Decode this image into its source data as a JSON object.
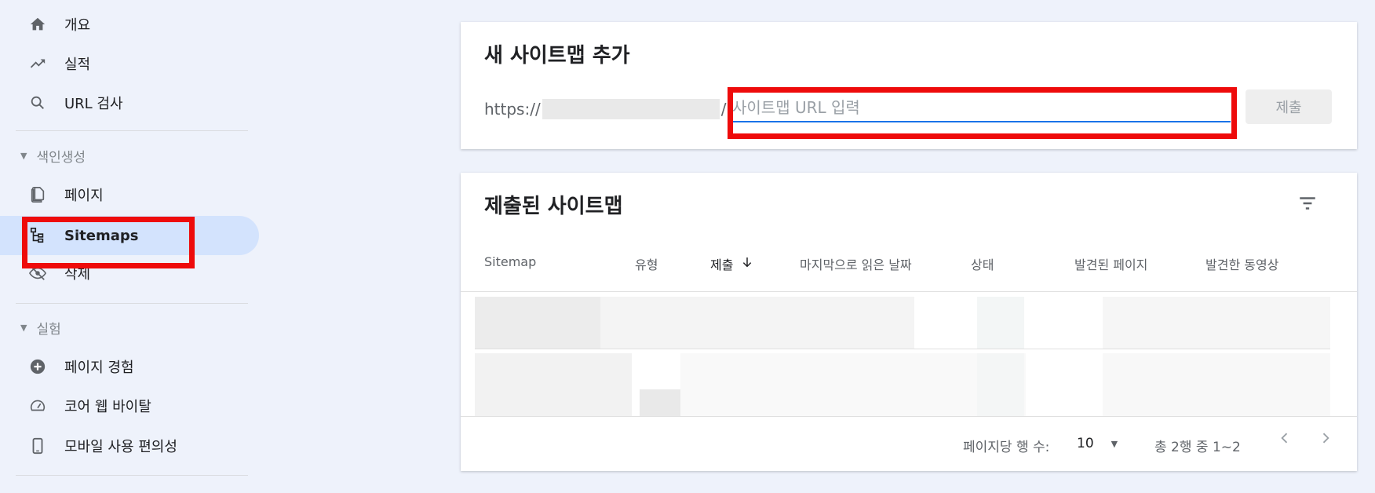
{
  "sidebar": {
    "items": [
      {
        "label": "개요",
        "icon": "home-icon"
      },
      {
        "label": "실적",
        "icon": "trending-up-icon"
      },
      {
        "label": "URL 검사",
        "icon": "search-icon"
      }
    ],
    "index_section": {
      "title": "색인생성",
      "items": [
        {
          "label": "페이지",
          "icon": "pages-icon"
        },
        {
          "label": "Sitemaps",
          "icon": "sitemap-icon",
          "active": true
        },
        {
          "label": "삭제",
          "icon": "visibility-off-icon"
        }
      ]
    },
    "experience_section": {
      "title": "실험",
      "items": [
        {
          "label": "페이지 경험",
          "icon": "plus-circle-icon"
        },
        {
          "label": "코어 웹 바이탈",
          "icon": "speed-gauge-icon"
        },
        {
          "label": "모바일 사용 편의성",
          "icon": "smartphone-icon"
        }
      ]
    }
  },
  "add_sitemap": {
    "title": "새 사이트맵 추가",
    "url_prefix": "https://",
    "url_suffix": "/",
    "input_value": "",
    "input_placeholder": "사이트맵 URL 입력",
    "submit_label": "제출"
  },
  "submitted_sitemaps": {
    "title": "제출된 사이트맵",
    "filter_icon": "filter-icon",
    "columns": [
      {
        "label": "Sitemap"
      },
      {
        "label": "유형"
      },
      {
        "label": "제출",
        "sorted": true,
        "sort_icon": "arrow-down-icon"
      },
      {
        "label": "마지막으로 읽은 날짜"
      },
      {
        "label": "상태"
      },
      {
        "label": "발견된 페이지"
      },
      {
        "label": "발견한 동영상"
      }
    ],
    "footer": {
      "rows_per_page_label": "페이지당 행 수:",
      "rows_per_page_value": "10",
      "range_text": "총 2행 중 1~2"
    }
  },
  "colors": {
    "accent": "#1a73e8",
    "active_nav": "#d3e3fd",
    "highlight_red": "#ee0b0b",
    "background": "#eef2fb"
  }
}
